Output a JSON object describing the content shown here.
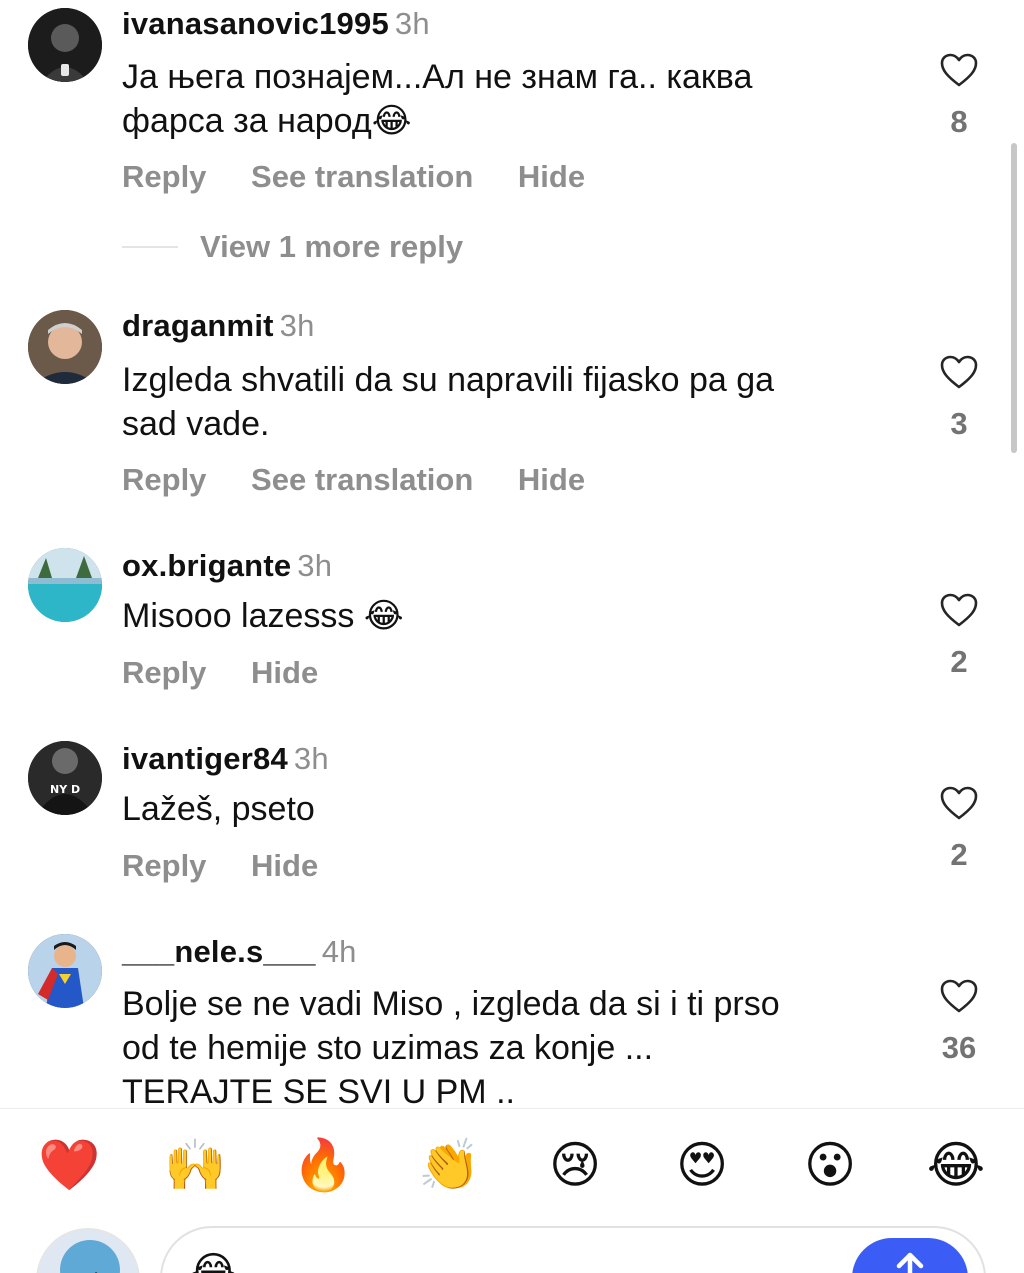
{
  "comments": [
    {
      "username": "ivanasanovic1995",
      "time": "3h",
      "lines": [
        "Ја њега познајем...Ал не знам га.. каква",
        "фарса за народ😂"
      ],
      "actions": [
        "Reply",
        "See translation",
        "Hide"
      ],
      "likes": "8",
      "more_replies": "View 1 more reply"
    },
    {
      "username": "draganmit",
      "time": "3h",
      "lines": [
        "Izgleda shvatili da su napravili fijasko pa ga",
        "sad vade."
      ],
      "actions": [
        "Reply",
        "See translation",
        "Hide"
      ],
      "likes": "3"
    },
    {
      "username": "ox.brigante",
      "time": "3h",
      "lines": [
        "Misooo lazesss 😂"
      ],
      "actions": [
        "Reply",
        "Hide"
      ],
      "likes": "2"
    },
    {
      "username": "ivantiger84",
      "time": "3h",
      "lines": [
        "Lažeš, pseto"
      ],
      "actions": [
        "Reply",
        "Hide"
      ],
      "likes": "2"
    },
    {
      "username": "___nele.s___",
      "time": "4h",
      "lines": [
        "Bolje se ne vadi Miso , izgleda da si i ti prso",
        "od te hemije sto uzimas za konje ...",
        "TERAJTE SE SVI U PM .."
      ],
      "likes": "36"
    }
  ],
  "reactions": [
    {
      "emoji": "❤️",
      "icon": "red-heart-icon"
    },
    {
      "emoji": "🙌",
      "icon": "raising-hands-icon"
    },
    {
      "emoji": "🔥",
      "icon": "fire-icon"
    },
    {
      "emoji": "👏",
      "icon": "clapping-hands-icon"
    },
    {
      "emoji": "😢",
      "icon": "crying-face-icon"
    },
    {
      "emoji": "😍",
      "icon": "heart-eyes-icon"
    },
    {
      "emoji": "😮",
      "icon": "surprised-face-icon"
    },
    {
      "emoji": "😂",
      "icon": "tears-of-joy-icon"
    }
  ],
  "composer": {
    "input_emoji": "😂",
    "send_icon": "arrow-up-icon"
  },
  "colors": {
    "muted_text": "#8e8e8e",
    "send_button": "#3b5cf5"
  }
}
